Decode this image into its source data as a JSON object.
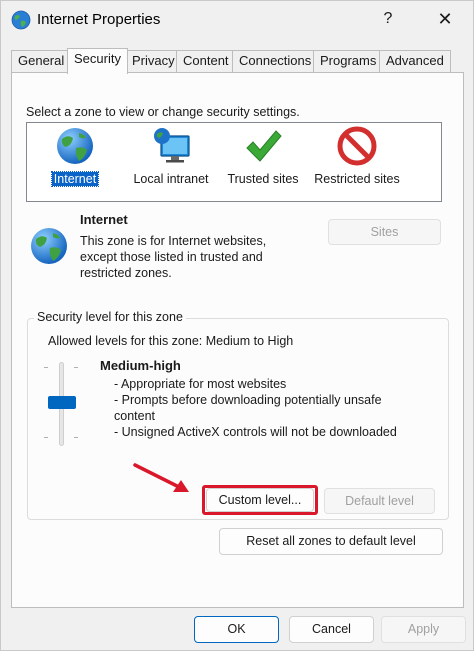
{
  "window": {
    "title": "Internet Properties",
    "help_label": "?",
    "close_label": "✕"
  },
  "tabs": [
    {
      "label": "General"
    },
    {
      "label": "Security"
    },
    {
      "label": "Privacy"
    },
    {
      "label": "Content"
    },
    {
      "label": "Connections"
    },
    {
      "label": "Programs"
    },
    {
      "label": "Advanced"
    }
  ],
  "active_tab": "Security",
  "zones": {
    "prompt": "Select a zone to view or change security settings.",
    "items": [
      {
        "label": "Internet",
        "icon": "globe-icon",
        "selected": true
      },
      {
        "label": "Local intranet",
        "icon": "monitor-globe-icon",
        "selected": false
      },
      {
        "label": "Trusted sites",
        "icon": "green-checkmark-icon",
        "selected": false
      },
      {
        "label": "Restricted sites",
        "icon": "no-entry-icon",
        "selected": false
      }
    ]
  },
  "zone_info": {
    "title": "Internet",
    "description": "This zone is for Internet websites, except those listed in trusted and restricted zones.",
    "sites_button": "Sites"
  },
  "security_level": {
    "group_title": "Security level for this zone",
    "allowed": "Allowed levels for this zone: Medium to High",
    "level_name": "Medium-high",
    "lines": [
      "- Appropriate for most websites",
      "- Prompts before downloading potentially unsafe content",
      "- Unsigned ActiveX controls will not be downloaded"
    ],
    "custom_button": "Custom level...",
    "default_button": "Default level"
  },
  "reset_button": "Reset all zones to default level",
  "footer": {
    "ok": "OK",
    "cancel": "Cancel",
    "apply": "Apply"
  },
  "colors": {
    "selection": "#0a64c8",
    "slider": "#0067c0",
    "highlight": "#d9192b"
  }
}
